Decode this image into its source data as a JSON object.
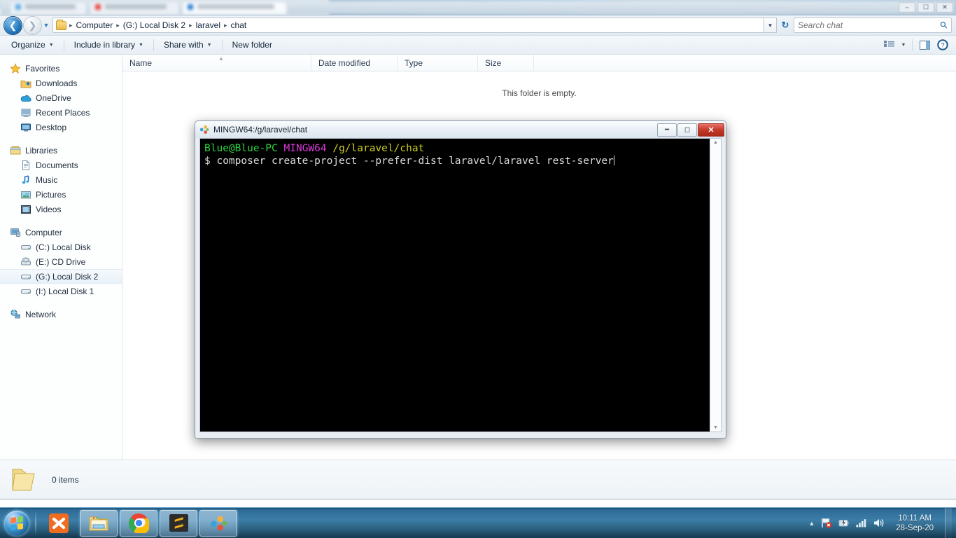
{
  "background_browser": {
    "tabs": [
      {
        "title": "How to use Postman Method",
        "favicon_color": "#5aa9e6"
      },
      {
        "title": "Installation  Laravel  The PHP F",
        "favicon_color": "#e8453c"
      },
      {
        "title": "Make REST API using web API with",
        "favicon_color": "#2f7fd1"
      }
    ],
    "window_buttons": [
      "minimize",
      "restore",
      "close"
    ]
  },
  "explorer": {
    "address": {
      "back_label": "Back",
      "forward_label": "Forward",
      "history_label": "Recent pages",
      "breadcrumbs": [
        "Computer",
        "(G:) Local Disk 2",
        "laravel",
        "chat"
      ],
      "refresh_label": "Refresh"
    },
    "search": {
      "placeholder": "Search chat",
      "value": ""
    },
    "toolbar": {
      "organize": "Organize",
      "include_in_library": "Include in library",
      "share_with": "Share with",
      "new_folder": "New folder",
      "view_label": "Change your view",
      "preview_label": "Show the preview pane",
      "help_label": "Get help"
    },
    "navigation_pane": [
      {
        "label": "Favorites",
        "icon": "star-icon",
        "level": "head"
      },
      {
        "label": "Downloads",
        "icon": "downloads-icon",
        "level": "child"
      },
      {
        "label": "OneDrive",
        "icon": "onedrive-icon",
        "level": "child"
      },
      {
        "label": "Recent Places",
        "icon": "recent-places-icon",
        "level": "child"
      },
      {
        "label": "Desktop",
        "icon": "desktop-icon",
        "level": "child"
      },
      {
        "label": "Libraries",
        "icon": "libraries-icon",
        "level": "head"
      },
      {
        "label": "Documents",
        "icon": "documents-icon",
        "level": "child"
      },
      {
        "label": "Music",
        "icon": "music-icon",
        "level": "child"
      },
      {
        "label": "Pictures",
        "icon": "pictures-icon",
        "level": "child"
      },
      {
        "label": "Videos",
        "icon": "videos-icon",
        "level": "child"
      },
      {
        "label": "Computer",
        "icon": "computer-icon",
        "level": "head"
      },
      {
        "label": "(C:) Local Disk",
        "icon": "drive-icon",
        "level": "child"
      },
      {
        "label": "(E:) CD Drive",
        "icon": "cd-drive-icon",
        "level": "child"
      },
      {
        "label": "(G:) Local Disk 2",
        "icon": "drive-icon",
        "level": "child",
        "selected": true
      },
      {
        "label": "(I:) Local Disk 1",
        "icon": "drive-icon",
        "level": "child"
      },
      {
        "label": "Network",
        "icon": "network-icon",
        "level": "head"
      }
    ],
    "columns": [
      {
        "label": "Name",
        "sorted": "ascending"
      },
      {
        "label": "Date modified"
      },
      {
        "label": "Type"
      },
      {
        "label": "Size"
      }
    ],
    "file_list": {
      "empty_message": "This folder is empty.",
      "rows": []
    },
    "status_bar": {
      "item_count": "0 items",
      "icon": "folder-icon"
    }
  },
  "terminal": {
    "title": "MINGW64:/g/laravel/chat",
    "icon": "git-bash-icon",
    "window_buttons": {
      "minimize": "–",
      "maximize": "□",
      "close": "✕"
    },
    "lines": [
      {
        "segments": [
          {
            "text": "Blue@Blue-PC",
            "color": "#2fd33f"
          },
          {
            "text": " "
          },
          {
            "text": "MINGW64",
            "color": "#d83ad8"
          },
          {
            "text": " "
          },
          {
            "text": "/g/laravel/chat",
            "color": "#cdcd22"
          }
        ]
      },
      {
        "segments": [
          {
            "text": "$ composer create-project --prefer-dist laravel/laravel rest-server",
            "color": "#dcdcdc"
          }
        ]
      }
    ],
    "prompt_user": "Blue@Blue-PC",
    "prompt_shell": "MINGW64",
    "prompt_path": "/g/laravel/chat",
    "command": "$ composer create-project --prefer-dist laravel/laravel rest-server",
    "colors": {
      "user": "#2fd33f",
      "shell": "#d83ad8",
      "path": "#cdcd22",
      "text": "#dcdcdc",
      "background": "#000000"
    }
  },
  "taskbar": {
    "start_label": "Start",
    "apps": [
      {
        "name": "xampp-control-panel",
        "label": "XAMPP Control Panel",
        "running": false
      },
      {
        "name": "windows-explorer",
        "label": "Windows Explorer",
        "running": true
      },
      {
        "name": "google-chrome",
        "label": "Google Chrome",
        "running": true
      },
      {
        "name": "sublime-text",
        "label": "Sublime Text",
        "running": true
      },
      {
        "name": "git-bash",
        "label": "MINGW64:/g/laravel/chat",
        "running": true
      }
    ],
    "tray": {
      "show_hidden_label": "Show hidden icons",
      "icons": [
        "action-center-icon",
        "battery-icon",
        "network-icon",
        "volume-icon"
      ],
      "time": "10:11 AM",
      "date": "28-Sep-20"
    }
  }
}
